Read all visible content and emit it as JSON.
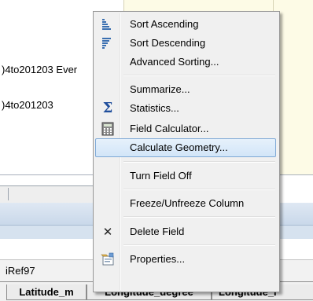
{
  "background": {
    "text_line1": ")4to201203 Ever",
    "text_line2": ")4to201203",
    "ref_text": "iRef97",
    "column_headers": [
      "Latitude_m",
      "Longitude_degree",
      "Longitude_r"
    ]
  },
  "context_menu": {
    "items": [
      {
        "label": "Sort Ascending",
        "icon": "sort-ascending-icon"
      },
      {
        "label": "Sort Descending",
        "icon": "sort-descending-icon"
      },
      {
        "label": "Advanced Sorting...",
        "icon": ""
      },
      {
        "label": "Summarize...",
        "icon": ""
      },
      {
        "label": "Statistics...",
        "icon": "sigma-icon",
        "glyph": "Σ"
      },
      {
        "label": "Field Calculator...",
        "icon": "calculator-icon"
      },
      {
        "label": "Calculate Geometry...",
        "icon": "",
        "highlighted": true
      },
      {
        "label": "Turn Field Off",
        "icon": ""
      },
      {
        "label": "Freeze/Unfreeze Column",
        "icon": ""
      },
      {
        "label": "Delete Field",
        "icon": "delete-x-icon",
        "glyph": "✕"
      },
      {
        "label": "Properties...",
        "icon": "properties-icon"
      }
    ]
  },
  "colors": {
    "highlight_border": "#7fa9d6",
    "highlight_fill": "#d2e5f8",
    "sigma_blue": "#1f4e9c",
    "panel_yellow": "#fdfbe6"
  }
}
